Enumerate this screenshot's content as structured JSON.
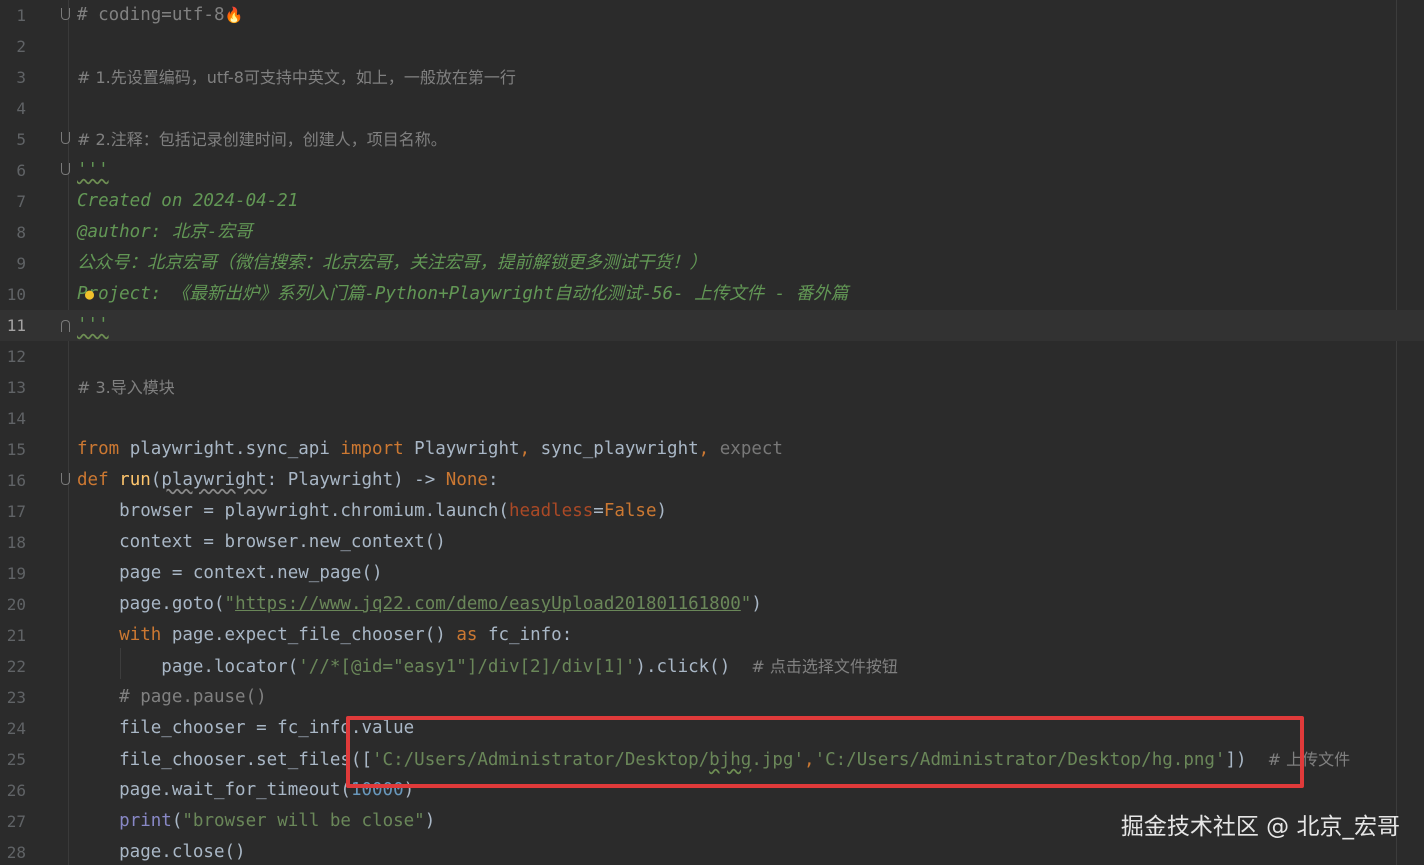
{
  "lines": [
    {
      "n": "1",
      "l1": "# coding=utf-8",
      "l2": "🔥"
    },
    {
      "n": "2"
    },
    {
      "n": "3",
      "l1": "# 1.先设置编码，utf-8可支持中英文，如上，一般放在第一行"
    },
    {
      "n": "4"
    },
    {
      "n": "5",
      "l1": "# 2.注释：包括记录创建时间，创建人，项目名称。"
    },
    {
      "n": "6",
      "l1": "'''"
    },
    {
      "n": "7",
      "l1": "Created on 2024-04-21"
    },
    {
      "n": "8",
      "l1": "@author:",
      "l2": " 北京-宏哥"
    },
    {
      "n": "9",
      "l1": "公众号：北京宏哥（微信搜索：北京宏哥，关注宏哥，提前解锁更多测试干货！）"
    },
    {
      "n": "10",
      "l1": "Project: 《最新出炉》系列入门篇-Python+Playwright自动化测试-56- 上传文件 - 番外篇"
    },
    {
      "n": "11",
      "l1": "'''"
    },
    {
      "n": "12"
    },
    {
      "n": "13",
      "l1": "# 3.导入模块"
    },
    {
      "n": "14"
    },
    {
      "n": "15",
      "l1": "from",
      "l2": " playwright.sync_api ",
      "l3": "import",
      "l4": " Playwright",
      "l5": ",",
      "l6": " sync_playwright",
      "l7": ",",
      "l8": " expect"
    },
    {
      "n": "16",
      "l1": "def",
      "l2": " ",
      "l3": "run",
      "l4": "(",
      "l5": "playwright",
      "l6": ": Playwright) -> ",
      "l7": "None",
      "l8": ":"
    },
    {
      "n": "17",
      "l1": "    browser = playwright.chromium.launch(",
      "l2": "headless",
      "l3": "=",
      "l4": "False",
      "l5": ")"
    },
    {
      "n": "18",
      "l1": "    context = browser.new_context()"
    },
    {
      "n": "19",
      "l1": "    page = context.new_page()"
    },
    {
      "n": "20",
      "l1": "    page.goto(",
      "l2": "\"",
      "l3": "https://www.jq22.com/demo/easyUpload201801161800",
      "l4": "\"",
      "l5": ")"
    },
    {
      "n": "21",
      "l1": "    ",
      "l2": "with",
      "l3": " page.expect_file_chooser() ",
      "l4": "as",
      "l5": " fc_info:"
    },
    {
      "n": "22",
      "l1": "        page.locator(",
      "l2": "'//*[@id=\"easy1\"]/div[2]/div[1]'",
      "l3": ").click()  ",
      "l4": "# 点击选择文件按钮"
    },
    {
      "n": "23",
      "l1": "    # page.pause()"
    },
    {
      "n": "24",
      "l1": "    file_chooser = fc_info.value"
    },
    {
      "n": "25",
      "l1": "    file_chooser.set_files([",
      "l2": "'C:/Users/Administrator/Desktop/",
      "l3": "bjhg",
      "l4": ".jpg'",
      "l5": ",",
      "l6": "'C:/Users/Administrator/Desktop/hg.png'",
      "l7": "])  ",
      "l8": "# 上传文件"
    },
    {
      "n": "26",
      "l1": "    page.wait_for_timeout(",
      "l2": "10000",
      "l3": ")"
    },
    {
      "n": "27",
      "l1": "    ",
      "l2": "print",
      "l3": "(",
      "l4": "\"browser will be close\"",
      "l5": ")"
    },
    {
      "n": "28",
      "l1": "    page.close()"
    }
  ],
  "watermark": "掘金技术社区 @ 北京_宏哥",
  "colors": {
    "background": "#2b2b2b",
    "keyword": "#cc7832",
    "string": "#6a8759",
    "docstring": "#629755",
    "comment": "#808080",
    "function": "#ffc66d",
    "parameter": "#aa4926",
    "highlight_box": "#e03a3a"
  }
}
